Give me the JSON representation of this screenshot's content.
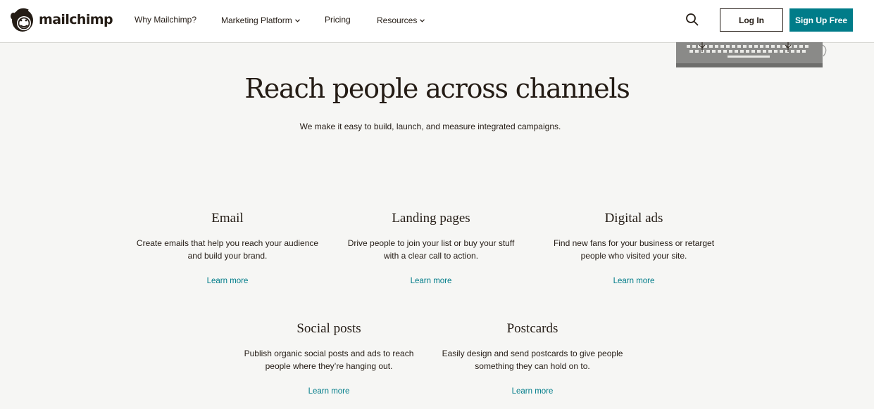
{
  "header": {
    "logo_text": "mailchimp",
    "nav": [
      {
        "label": "Why Mailchimp?",
        "has_dropdown": false
      },
      {
        "label": "Marketing Platform",
        "has_dropdown": true
      },
      {
        "label": "Pricing",
        "has_dropdown": false
      },
      {
        "label": "Resources",
        "has_dropdown": true
      }
    ],
    "search_icon": "search-icon",
    "login_label": "Log In",
    "signup_label": "Sign Up Free"
  },
  "hero": {
    "title": "Reach people across channels",
    "subtitle": "We make it easy to build, launch, and measure integrated campaigns."
  },
  "channels": [
    {
      "title": "Email",
      "description": "Create emails that help you reach your audience and build your brand.",
      "link": "Learn more"
    },
    {
      "title": "Landing pages",
      "description": "Drive people to join your list or buy your stuff with a clear call to action.",
      "link": "Learn more"
    },
    {
      "title": "Digital ads",
      "description": "Find new fans for your business or retarget people who visited your site.",
      "link": "Learn more"
    },
    {
      "title": "Social posts",
      "description": "Publish organic social posts and ads to reach people where they’re hanging out.",
      "link": "Learn more"
    },
    {
      "title": "Postcards",
      "description": "Easily design and send postcards to give people something they can hold on to.",
      "link": "Learn more"
    }
  ],
  "colors": {
    "accent": "#007c89",
    "text": "#241c15",
    "background": "#f6f6f4",
    "header_bg": "#ffffff"
  }
}
